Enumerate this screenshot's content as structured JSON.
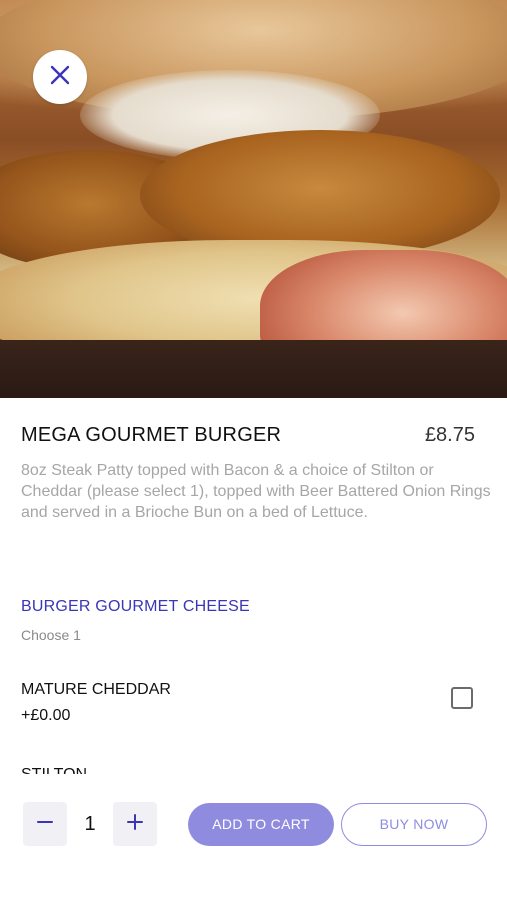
{
  "product": {
    "title": "MEGA GOURMET BURGER",
    "price": "£8.75",
    "description": "8oz Steak Patty topped with Bacon & a choice of Stilton or Cheddar (please select 1), topped with Beer Battered Onion Rings and served in a Brioche Bun on a bed of Lettuce."
  },
  "options_group": {
    "title": "BURGER GOURMET CHEESE",
    "subtitle": "Choose 1",
    "items": [
      {
        "name": "MATURE CHEDDAR",
        "price": "+£0.00",
        "checked": false
      },
      {
        "name": "STILTON"
      }
    ]
  },
  "actions": {
    "quantity": "1",
    "add_to_cart_label": "ADD TO CART",
    "buy_now_label": "BUY NOW"
  },
  "icons": {
    "close": "close-icon",
    "minus": "minus-icon",
    "plus": "plus-icon"
  },
  "colors": {
    "accent": "#3b35b8",
    "button_fill": "#8f8ce0",
    "description_text": "#a6a6a6"
  }
}
